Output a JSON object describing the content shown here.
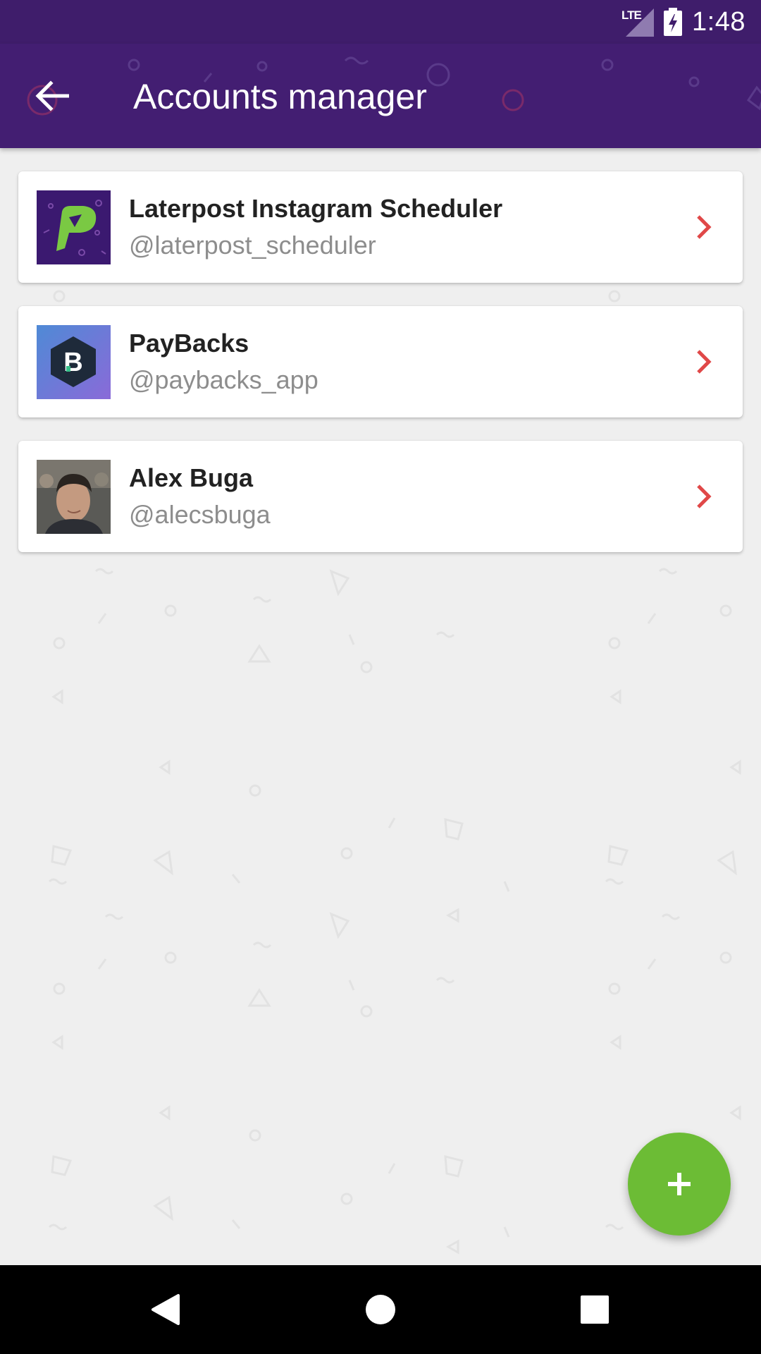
{
  "status_bar": {
    "network_label": "LTE",
    "time": "1:48"
  },
  "app_bar": {
    "title": "Accounts manager"
  },
  "accounts": [
    {
      "name": "Laterpost Instagram Scheduler",
      "handle": "@laterpost_scheduler",
      "avatar": "laterpost-logo"
    },
    {
      "name": "PayBacks",
      "handle": "@paybacks_app",
      "avatar": "paybacks-logo"
    },
    {
      "name": "Alex Buga",
      "handle": "@alecsbuga",
      "avatar": "profile-photo"
    }
  ],
  "colors": {
    "primary": "#431e72",
    "status_bar": "#3f1d6b",
    "accent_fab": "#6cbc35",
    "chevron": "#e04848",
    "background": "#efefef"
  }
}
